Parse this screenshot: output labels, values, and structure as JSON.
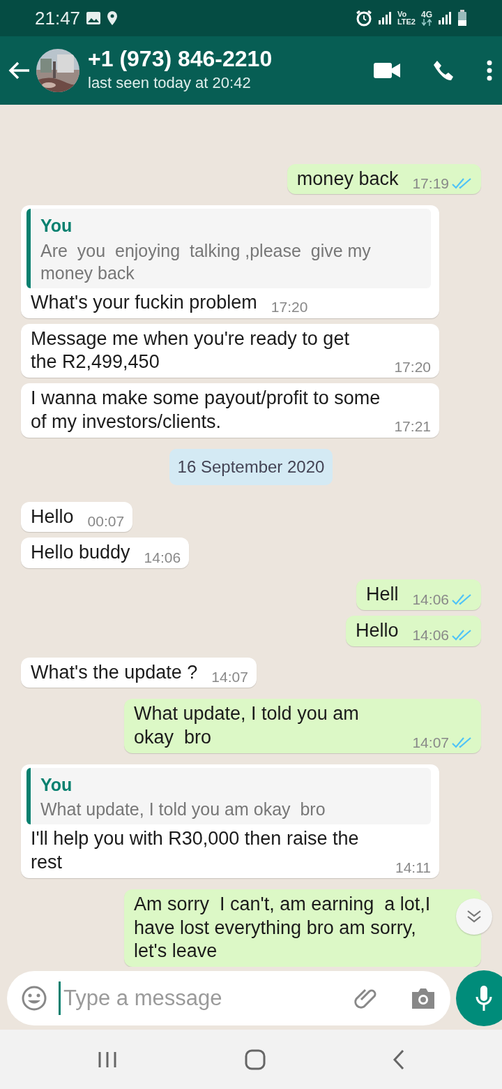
{
  "status_bar": {
    "time": "21:47",
    "volte_top": "Vo",
    "volte_bottom": "LTE2",
    "network": "4G"
  },
  "header": {
    "title": "+1 (973) 846-2210",
    "subtitle": "last seen today at 20:42"
  },
  "messages": [
    {
      "kind": "out",
      "text": "money back",
      "time": "17:19",
      "read": true
    },
    {
      "kind": "in",
      "quote": {
        "author": "You",
        "text": "Are  you  enjoying  talking ,please  give my money back"
      },
      "text": "What's your fuckin problem",
      "time": "17:20"
    },
    {
      "kind": "in",
      "text": "Message me when you're ready to get the R2,499,450",
      "time": "17:20"
    },
    {
      "kind": "in",
      "text": "I wanna make some payout/profit to some of my investors/clients.",
      "time": "17:21"
    },
    {
      "kind": "date",
      "text": "16 September 2020"
    },
    {
      "kind": "in",
      "text": "Hello",
      "time": "00:07"
    },
    {
      "kind": "in",
      "text": "Hello buddy",
      "time": "14:06"
    },
    {
      "kind": "out",
      "text": "Hell",
      "time": "14:06",
      "read": true
    },
    {
      "kind": "out",
      "text": "Hello",
      "time": "14:06",
      "read": true
    },
    {
      "kind": "in",
      "text": "What's the update ?",
      "time": "14:07"
    },
    {
      "kind": "out",
      "text": "What update, I told you am okay  bro",
      "time": "14:07",
      "read": true
    },
    {
      "kind": "in",
      "quote": {
        "author": "You",
        "text": "What update, I told you am okay  bro"
      },
      "text": "I'll help you with R30,000 then raise the rest",
      "time": "14:11"
    },
    {
      "kind": "out",
      "text": "Am sorry  I can't, am earning  a lot,I have lost everything bro am sorry, let's leave"
    }
  ],
  "composer": {
    "placeholder": "Type a message"
  }
}
